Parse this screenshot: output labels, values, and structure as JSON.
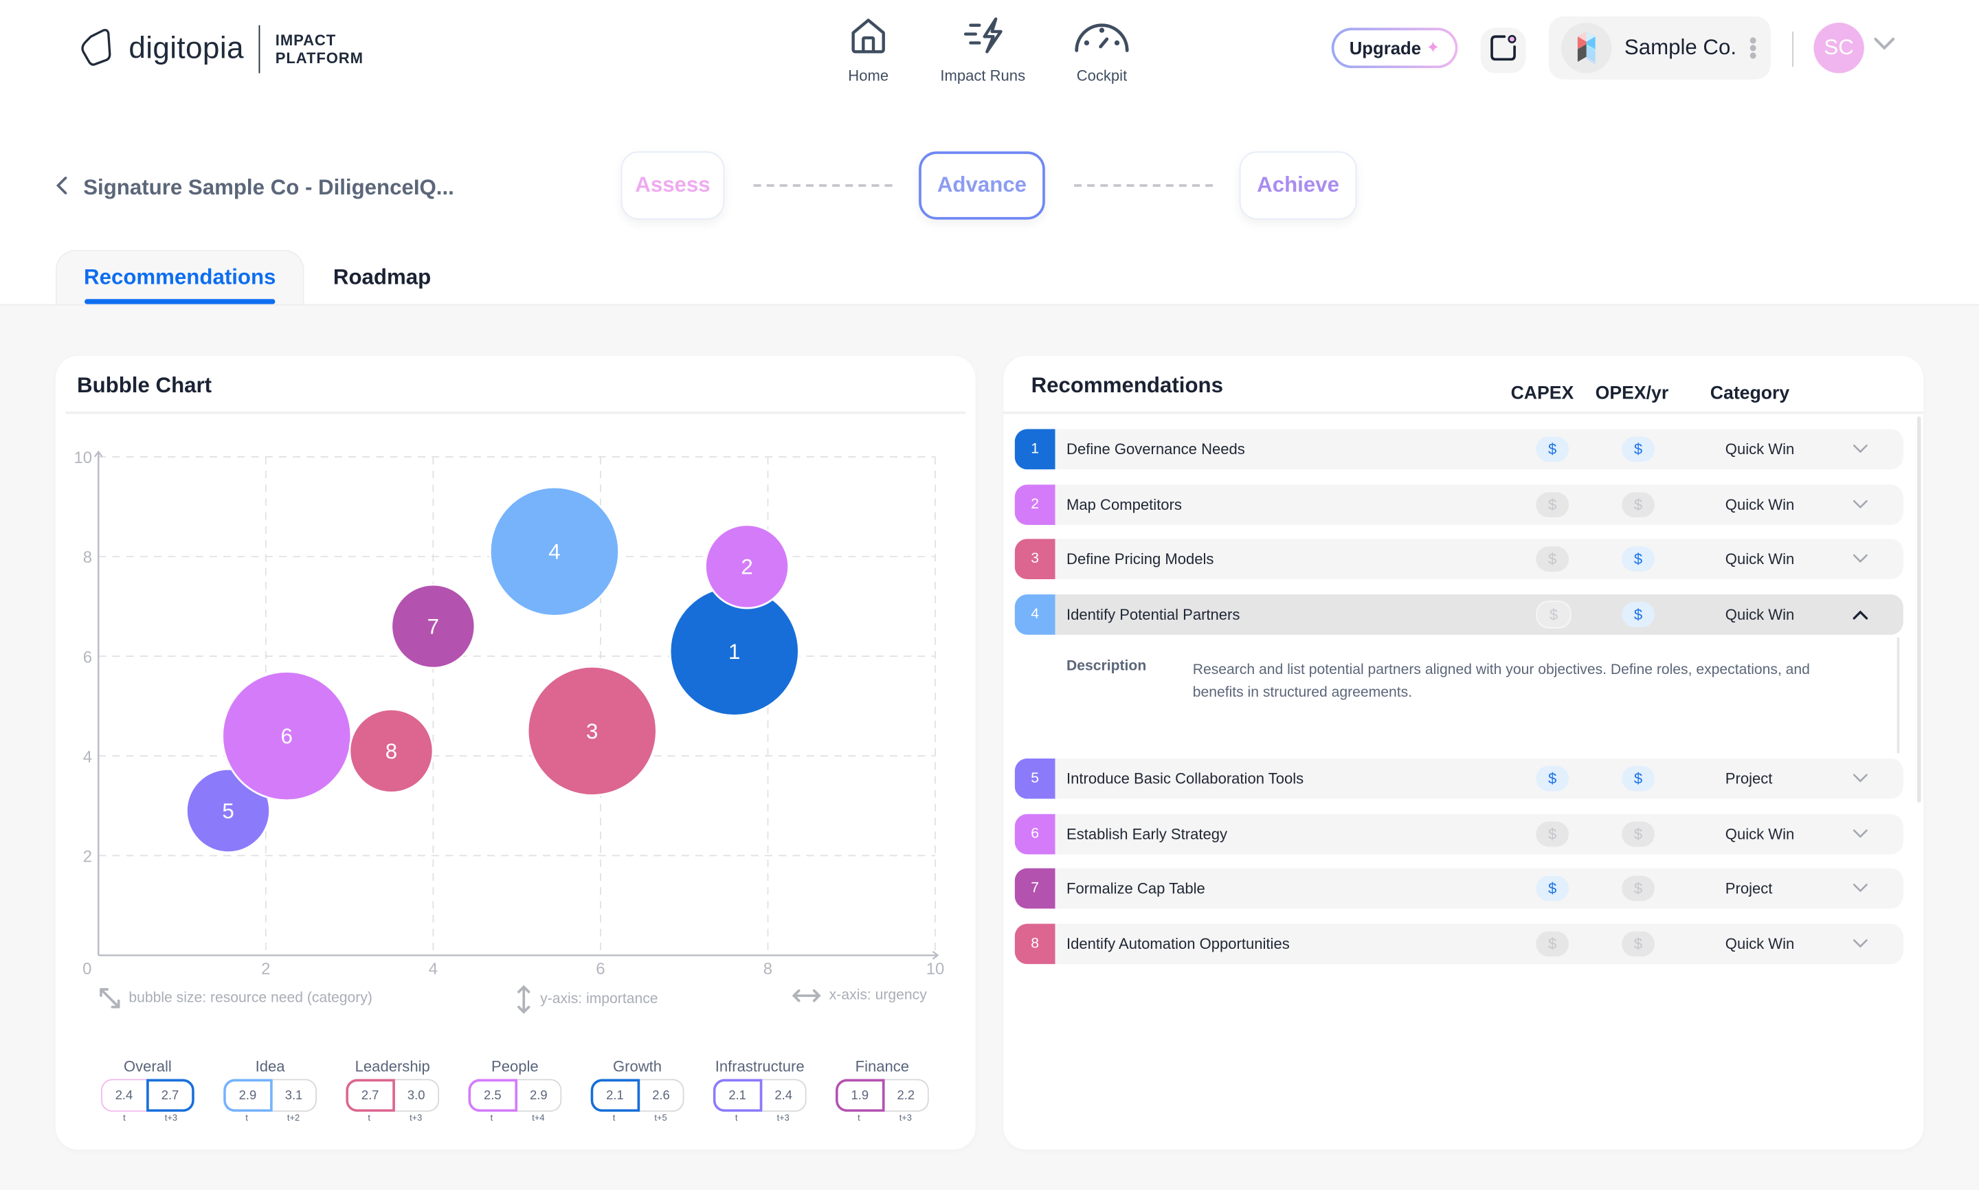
{
  "header": {
    "logo_word": "digitopia",
    "logo_sub_line1": "IMPACT",
    "logo_sub_line2": "PLATFORM",
    "nav": [
      {
        "label": "Home",
        "icon": "home-icon"
      },
      {
        "label": "Impact Runs",
        "icon": "lightning-icon"
      },
      {
        "label": "Cockpit",
        "icon": "gauge-icon"
      }
    ],
    "upgrade_label": "Upgrade",
    "company_name": "Sample Co.",
    "avatar_initials": "SC"
  },
  "subheader": {
    "back_label": "Signature Sample Co - DiligenceIQ...",
    "steps": [
      {
        "label": "Assess",
        "color": "#eeaaf0",
        "active": false
      },
      {
        "label": "Advance",
        "color": "#8c9cf2",
        "active": true
      },
      {
        "label": "Achieve",
        "color": "#a98cf0",
        "active": false
      }
    ],
    "tabs": [
      {
        "label": "Recommendations",
        "active": true
      },
      {
        "label": "Roadmap",
        "active": false
      }
    ]
  },
  "bubble_card": {
    "title": "Bubble Chart",
    "notes": {
      "size": "bubble size: resource need (category)",
      "y": "y-axis: importance",
      "x": "x-axis: urgency"
    },
    "scores": [
      {
        "label": "Overall",
        "t": "2.4",
        "future": "2.7",
        "t_label": "t",
        "future_label": "t+3",
        "color": "#1a6fdc",
        "highlight": "future"
      },
      {
        "label": "Idea",
        "t": "2.9",
        "future": "3.1",
        "t_label": "t",
        "future_label": "t+2",
        "color": "#76b3fb",
        "highlight": "t"
      },
      {
        "label": "Leadership",
        "t": "2.7",
        "future": "3.0",
        "t_label": "t",
        "future_label": "t+3",
        "color": "#dc6690",
        "highlight": "t"
      },
      {
        "label": "People",
        "t": "2.5",
        "future": "2.9",
        "t_label": "t",
        "future_label": "t+4",
        "color": "#d47bfa",
        "highlight": "t"
      },
      {
        "label": "Growth",
        "t": "2.1",
        "future": "2.6",
        "t_label": "t",
        "future_label": "t+5",
        "color": "#176ed8",
        "highlight": "t"
      },
      {
        "label": "Infrastructure",
        "t": "2.1",
        "future": "2.4",
        "t_label": "t",
        "future_label": "t+3",
        "color": "#8b7bfb",
        "highlight": "t"
      },
      {
        "label": "Finance",
        "t": "1.9",
        "future": "2.2",
        "t_label": "t",
        "future_label": "t+3",
        "color": "#b452b0",
        "highlight": "t"
      }
    ]
  },
  "chart_data": {
    "type": "scatter",
    "title": "Bubble Chart",
    "xlabel": "urgency",
    "ylabel": "importance",
    "xlim": [
      0,
      10
    ],
    "ylim": [
      0,
      10
    ],
    "x_ticks": [
      "0",
      "2",
      "4",
      "6",
      "8",
      "10"
    ],
    "y_ticks": [
      "2",
      "4",
      "6",
      "8",
      "10"
    ],
    "grid": true,
    "points": [
      {
        "label": "1",
        "x": 7.6,
        "y": 6.1,
        "size": "large",
        "color": "#176ed8"
      },
      {
        "label": "2",
        "x": 7.75,
        "y": 7.8,
        "size": "small",
        "color": "#d47bfa"
      },
      {
        "label": "3",
        "x": 5.9,
        "y": 4.5,
        "size": "large",
        "color": "#dc6690"
      },
      {
        "label": "4",
        "x": 5.45,
        "y": 8.1,
        "size": "large",
        "color": "#76b3fb"
      },
      {
        "label": "5",
        "x": 1.55,
        "y": 2.9,
        "size": "small",
        "color": "#8b7bfb"
      },
      {
        "label": "6",
        "x": 2.25,
        "y": 4.4,
        "size": "large",
        "color": "#d47bfa"
      },
      {
        "label": "7",
        "x": 4.0,
        "y": 6.6,
        "size": "small",
        "color": "#b452b0"
      },
      {
        "label": "8",
        "x": 3.5,
        "y": 4.1,
        "size": "small",
        "color": "#dc6690"
      }
    ]
  },
  "recs": {
    "title": "Recommendations",
    "columns": {
      "capex": "CAPEX",
      "opex": "OPEX/yr",
      "category": "Category"
    },
    "description_label": "Description",
    "rows": [
      {
        "num": "1",
        "title": "Define Governance Needs",
        "capex": "on",
        "opex": "on",
        "category": "Quick Win",
        "color": "#176ed8",
        "open": false
      },
      {
        "num": "2",
        "title": "Map Competitors",
        "capex": "off",
        "opex": "off",
        "category": "Quick Win",
        "color": "#d47bfa",
        "open": false
      },
      {
        "num": "3",
        "title": "Define Pricing Models",
        "capex": "off",
        "opex": "on",
        "category": "Quick Win",
        "color": "#dc6690",
        "open": false
      },
      {
        "num": "4",
        "title": "Identify Potential Partners",
        "capex": "ghost",
        "opex": "on",
        "category": "Quick Win",
        "color": "#76b3fb",
        "open": true,
        "description": "Research and list potential partners aligned with your objectives. Define roles, expectations, and benefits in structured agreements."
      },
      {
        "num": "5",
        "title": "Introduce Basic Collaboration Tools",
        "capex": "on",
        "opex": "on",
        "category": "Project",
        "color": "#8b7bfb",
        "open": false
      },
      {
        "num": "6",
        "title": "Establish Early Strategy",
        "capex": "off",
        "opex": "off",
        "category": "Quick Win",
        "color": "#d47bfa",
        "open": false
      },
      {
        "num": "7",
        "title": "Formalize Cap Table",
        "capex": "on",
        "opex": "off",
        "category": "Project",
        "color": "#b452b0",
        "open": false
      },
      {
        "num": "8",
        "title": "Identify Automation Opportunities",
        "capex": "off",
        "opex": "off",
        "category": "Quick Win",
        "color": "#dc6690",
        "open": false
      }
    ],
    "currency_symbol": "$"
  }
}
